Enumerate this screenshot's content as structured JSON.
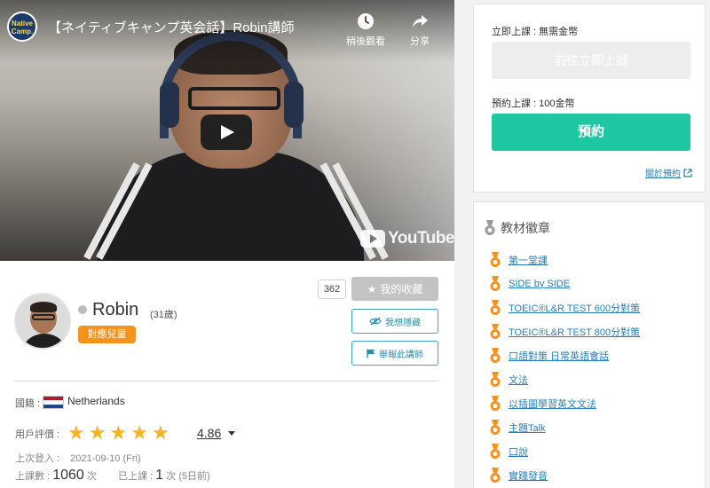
{
  "video": {
    "channel_logo_text": "Native Camp.",
    "title": "【ネイティブキャンプ英会話】Robin講師",
    "watch_later_label": "稍後觀看",
    "share_label": "分享",
    "youtube_label": "YouTube"
  },
  "profile": {
    "name": "Robin",
    "age": "(31歲)",
    "kids_badge": "對應兒童",
    "favorite_count": "362",
    "favorite_label": "我的收藏",
    "hide_label": "我想隱藏",
    "report_label": "舉報此講師",
    "nationality_label": "國籍 :",
    "nationality_value": "Netherlands",
    "flag_colors": [
      "#ae1c28",
      "#ffffff",
      "#21468b"
    ],
    "rating_label": "用戶評價 :",
    "rating_value": "4.86",
    "stars_filled": 5,
    "last_login_label": "上次登入 :",
    "last_login_value": "2021-09-10 (Fri)",
    "lesson_count_label": "上課數 :",
    "lesson_count_value": "1060",
    "lesson_count_unit": "次",
    "attended_label": "已上課 :",
    "attended_value": "1",
    "attended_unit": "次",
    "attended_note": "(5日前)"
  },
  "booking": {
    "instant_label": "立即上課 : 無需金幣",
    "instant_button": "前往立即上課",
    "reserve_label": "預約上課 : 100金幣",
    "reserve_button": "預約",
    "about_link": "關於預約"
  },
  "badges": {
    "title": "教材徽章",
    "items": [
      "第一堂課",
      "SIDE by SIDE",
      "TOEIC®L&R TEST 600分對策",
      "TOEIC®L&R TEST 800分對策",
      "口語對策 日常英語會話",
      "文法",
      "以插圖學習英文文法",
      "主題Talk",
      "口說",
      "實踐發音"
    ]
  },
  "colors": {
    "accent_green": "#1ec7a2",
    "badge_orange": "#f6921e",
    "star_yellow": "#f6b51e",
    "link_blue": "#2a7fb5"
  }
}
